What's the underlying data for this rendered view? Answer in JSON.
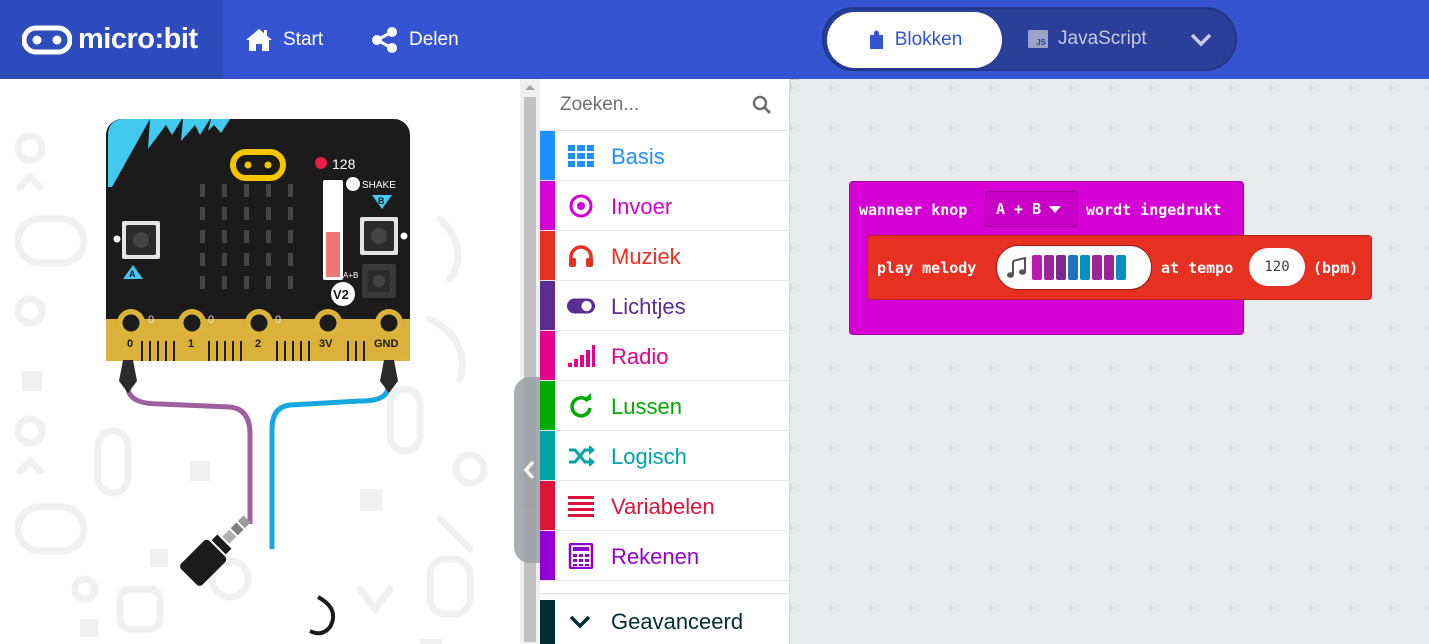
{
  "header": {
    "brand": "micro:bit",
    "start_label": "Start",
    "share_label": "Delen",
    "blocks_label": "Blokken",
    "javascript_label": "JavaScript",
    "js_icon_text": "JS",
    "header_color": "#3454d1"
  },
  "simulator": {
    "sound_level": "128",
    "shake_label": "SHAKE",
    "button_a": "A",
    "button_b": "B",
    "button_ab": "A+B",
    "version": "V2",
    "pins": [
      "0",
      "1",
      "2",
      "3V",
      "GND"
    ],
    "pin_values": [
      "0",
      "0",
      "0"
    ],
    "wire_colors": [
      "#a05fa0",
      "#17a7e0"
    ]
  },
  "toolbox": {
    "search_placeholder": "Zoeken...",
    "categories": [
      {
        "label": "Basis",
        "color": "#1e90ff",
        "icon": "grid-icon"
      },
      {
        "label": "Invoer",
        "color": "#d400d4",
        "icon": "target-icon"
      },
      {
        "label": "Muziek",
        "color": "#e63022",
        "icon": "headphones-icon"
      },
      {
        "label": "Lichtjes",
        "color": "#5c2d91",
        "icon": "toggle-icon"
      },
      {
        "label": "Radio",
        "color": "#e3008c",
        "icon": "signal-icon"
      },
      {
        "label": "Lussen",
        "color": "#00aa00",
        "icon": "refresh-icon"
      },
      {
        "label": "Logisch",
        "color": "#00a4a6",
        "icon": "shuffle-icon"
      },
      {
        "label": "Variabelen",
        "color": "#dc143c",
        "icon": "list-icon"
      },
      {
        "label": "Rekenen",
        "color": "#9400d3",
        "icon": "calculator-icon"
      }
    ],
    "advanced_label": "Geavanceerd",
    "advanced_color": "#002e33"
  },
  "workspace": {
    "event_block": {
      "prefix": "wanneer knop",
      "button_option": "A + B",
      "suffix": "wordt ingedrukt",
      "color": "#d400d4"
    },
    "music_block": {
      "label": "play melody",
      "tempo_label": "at tempo",
      "tempo_value": "120",
      "unit": "(bpm)",
      "color": "#e63022",
      "melody_colors": [
        "#bc19b3",
        "#9b249b",
        "#7d2a8f",
        "#1f74ba",
        "#0a8dc1",
        "#9b249b",
        "#9b249b",
        "#0a8dc1"
      ]
    }
  }
}
